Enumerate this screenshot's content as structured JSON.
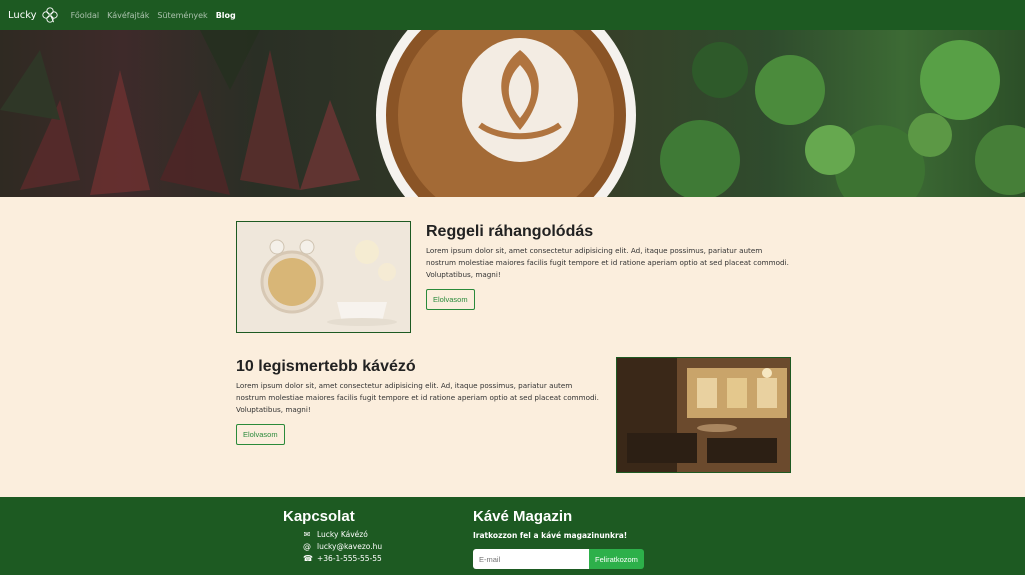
{
  "navbar": {
    "brand": "Lucky",
    "links": [
      "Főoldal",
      "Kávéfajták",
      "Sütemények",
      "Blog"
    ],
    "active": "Blog",
    "bg_color": "#1d5a22"
  },
  "hero": {
    "image": "coffee-latte-art-and-plants"
  },
  "articles": [
    {
      "title": "Reggeli ráhangolódás",
      "body": "Lorem ipsum dolor sit, amet consectetur adipisicing elit. Ad, itaque possimus, pariatur autem nostrum molestiae maiores facilis fugit tempore et id ratione aperiam optio at sed placeat commodi. Voluptatibus, magni!",
      "button": "Elolvasom",
      "image": "alarm-clock-coffee-cup"
    },
    {
      "title": "10 legismertebb kávézó",
      "body": "Lorem ipsum dolor sit, amet consectetur adipisicing elit. Ad, itaque possimus, pariatur autem nostrum molestiae maiores facilis fugit tempore et id ratione aperiam optio at sed placeat commodi. Voluptatibus, magni!",
      "button": "Elolvasom",
      "image": "cafe-interior"
    }
  ],
  "footer": {
    "contact_title": "Kapcsolat",
    "contact": [
      {
        "icon": "envelope-icon",
        "text": "Lucky Kávézó"
      },
      {
        "icon": "at-icon",
        "text": "lucky@kavezo.hu"
      },
      {
        "icon": "phone-icon",
        "text": "+36-1-555-55-55"
      }
    ],
    "newsletter_title": "Kávé Magazin",
    "newsletter_text": "Iratkozzon fel a kávé magazinunkra!",
    "email_placeholder": "E-mail",
    "subscribe_label": "Feliratkozom"
  }
}
